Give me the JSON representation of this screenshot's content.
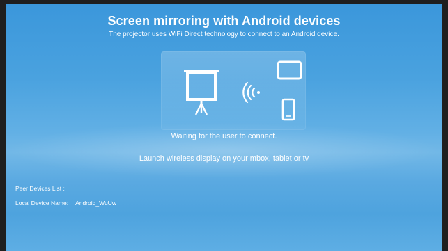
{
  "header": {
    "title": "Screen mirroring with Android devices",
    "subtitle": "The projector uses WiFi Direct technology to connect to an Android device."
  },
  "illustration": {
    "icons": [
      "projector-screen-icon",
      "wifi-signal-icon",
      "tablet-icon",
      "phone-icon"
    ]
  },
  "status": {
    "waiting": "Waiting for the user to connect.",
    "instruction": "Launch wireless display on your mbox, tablet or tv"
  },
  "device_info": {
    "peer_label": "Peer Devices List :",
    "local_label": "Local Device Name:",
    "local_value": "Android_WuUw"
  },
  "colors": {
    "background_top": "#3b97db",
    "background_mid": "#72b8e7",
    "text": "#ffffff",
    "frame": "#1f1f1f"
  }
}
